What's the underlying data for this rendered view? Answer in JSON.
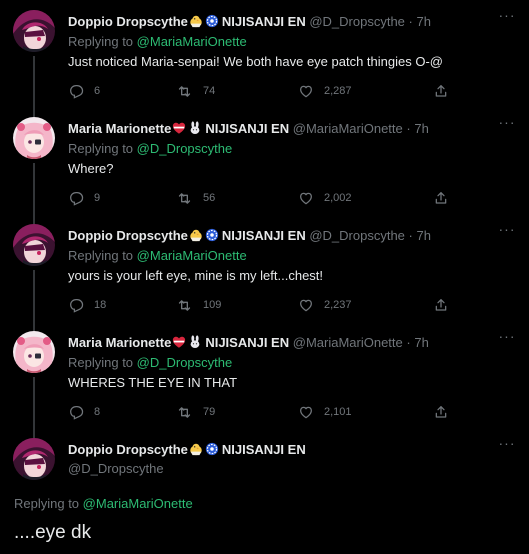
{
  "theme": {
    "background": "#000000",
    "text": "#e7e9ea",
    "muted": "#71767b",
    "mention": "#2dbb73"
  },
  "tweets": [
    {
      "display_name": "Doppio Dropscythe",
      "name_emoji": "chick-emoji",
      "org_icon": "nijisanji-logo-icon",
      "org": "NIJISANJI EN",
      "handle": "@D_Dropscythe",
      "dot": "·",
      "time": "7h",
      "replying_label": "Replying to",
      "replying_to": "@MariaMariOnette",
      "text": "Just noticed Maria-senpai! We both have eye patch thingies O-@",
      "replies": "6",
      "retweets": "74",
      "likes": "2,287"
    },
    {
      "display_name": "Maria Marionette",
      "name_emoji": "heart-ribbon-emoji",
      "org_icon": "rabbit-emoji",
      "org": "NIJISANJI EN",
      "handle": "@MariaMariOnette",
      "dot": "·",
      "time": "7h",
      "replying_label": "Replying to",
      "replying_to": "@D_Dropscythe",
      "text": "Where?",
      "replies": "9",
      "retweets": "56",
      "likes": "2,002"
    },
    {
      "display_name": "Doppio Dropscythe",
      "name_emoji": "chick-emoji",
      "org_icon": "nijisanji-logo-icon",
      "org": "NIJISANJI EN",
      "handle": "@D_Dropscythe",
      "dot": "·",
      "time": "7h",
      "replying_label": "Replying to",
      "replying_to": "@MariaMariOnette",
      "text": "yours is your left eye, mine is my left...chest!",
      "replies": "18",
      "retweets": "109",
      "likes": "2,237"
    },
    {
      "display_name": "Maria Marionette",
      "name_emoji": "heart-ribbon-emoji",
      "org_icon": "rabbit-emoji",
      "org": "NIJISANJI EN",
      "handle": "@MariaMariOnette",
      "dot": "·",
      "time": "7h",
      "replying_label": "Replying to",
      "replying_to": "@D_Dropscythe",
      "text": "WHERES THE EYE IN THAT",
      "replies": "8",
      "retweets": "79",
      "likes": "2,101"
    }
  ],
  "focused": {
    "display_name": "Doppio Dropscythe",
    "name_emoji": "chick-emoji",
    "org_icon": "nijisanji-logo-icon",
    "org": "NIJISANJI EN",
    "handle": "@D_Dropscythe",
    "replying_label": "Replying to",
    "replying_to": "@MariaMariOnette",
    "text": "....eye dk"
  }
}
